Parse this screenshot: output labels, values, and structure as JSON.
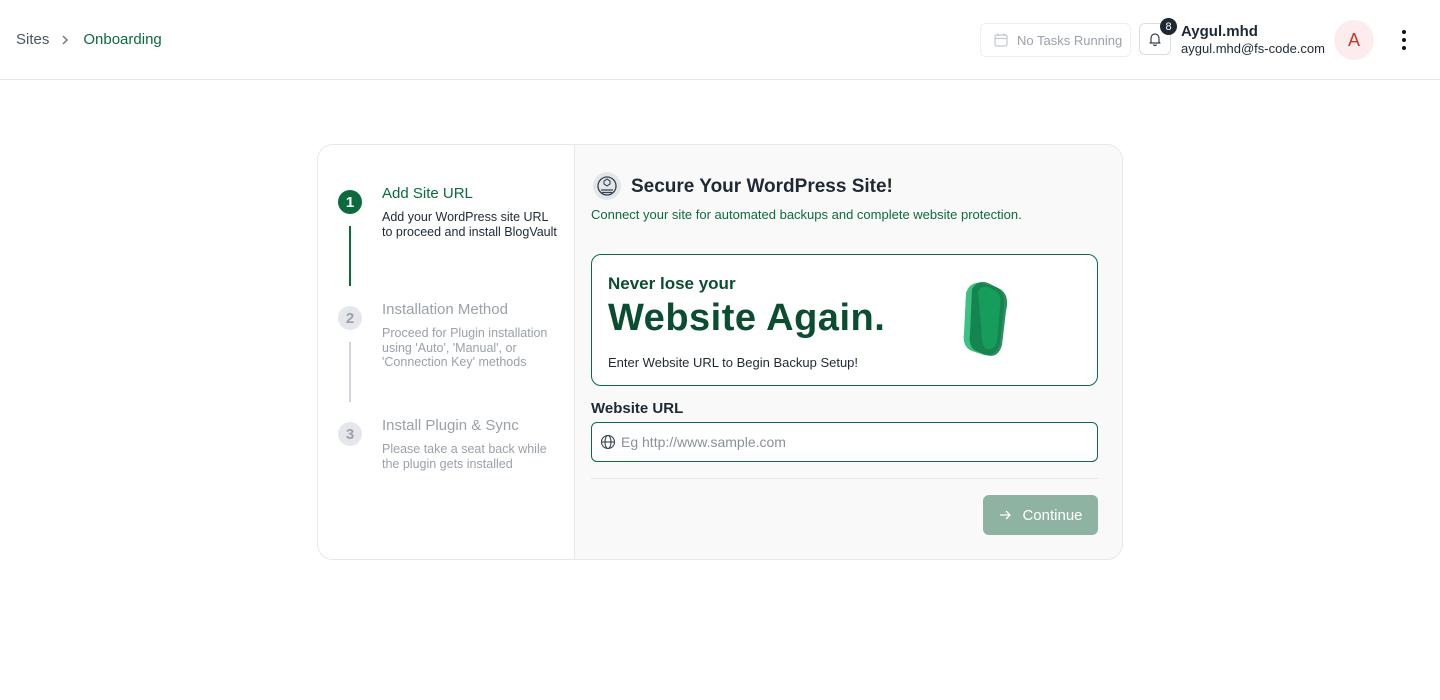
{
  "breadcrumb": {
    "root": "Sites",
    "current": "Onboarding"
  },
  "header": {
    "tasks_label": "No Tasks Running",
    "notification_count": "8",
    "user_name": "Aygul.mhd",
    "user_email": "aygul.mhd@fs-code.com",
    "avatar_initial": "A"
  },
  "steps": [
    {
      "number": "1",
      "title": "Add Site URL",
      "description": "Add your WordPress site URL to proceed and install BlogVault",
      "state": "active"
    },
    {
      "number": "2",
      "title": "Installation Method",
      "description": "Proceed for Plugin installation using 'Auto', 'Manual', or 'Connection Key' methods",
      "state": "inactive"
    },
    {
      "number": "3",
      "title": "Install Plugin & Sync",
      "description": "Please take a seat back while the plugin gets installed",
      "state": "inactive"
    }
  ],
  "main": {
    "title": "Secure Your WordPress Site!",
    "subtitle": "Connect your site for automated backups and complete website protection.",
    "banner": {
      "small": "Never lose your",
      "big": "Website Again.",
      "sub": "Enter Website URL to Begin Backup Setup!"
    },
    "field_label": "Website URL",
    "url_value": "",
    "url_placeholder": "Eg http://www.sample.com",
    "continue_label": "Continue"
  },
  "colors": {
    "brand_green": "#0b6b3e",
    "dark_green": "#0b4d31",
    "disabled_button": "#8fb3a2",
    "avatar_bg": "#fdecee",
    "avatar_text": "#c0392b"
  },
  "icons": {
    "breadcrumb_separator": "chevron-right-icon",
    "tasks": "calendar-icon",
    "notifications": "bell-icon",
    "menu": "kebab-menu-icon",
    "title": "wordpress-shield-icon",
    "url_field": "globe-icon",
    "continue": "arrow-right-icon"
  }
}
